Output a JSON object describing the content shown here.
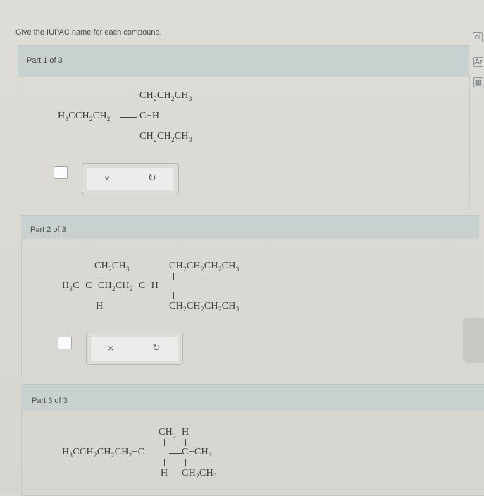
{
  "prompt": "Give the IUPAC name for each compound.",
  "parts": [
    {
      "title": "Part 1 of 3",
      "clear_icon": "×",
      "reset_icon": "↻"
    },
    {
      "title": "Part 2 of 3",
      "clear_icon": "×",
      "reset_icon": "↻"
    },
    {
      "title": "Part 3 of 3"
    }
  ],
  "side_icons": {
    "top": "ol",
    "middle": "Ar",
    "bottom": "▦"
  }
}
